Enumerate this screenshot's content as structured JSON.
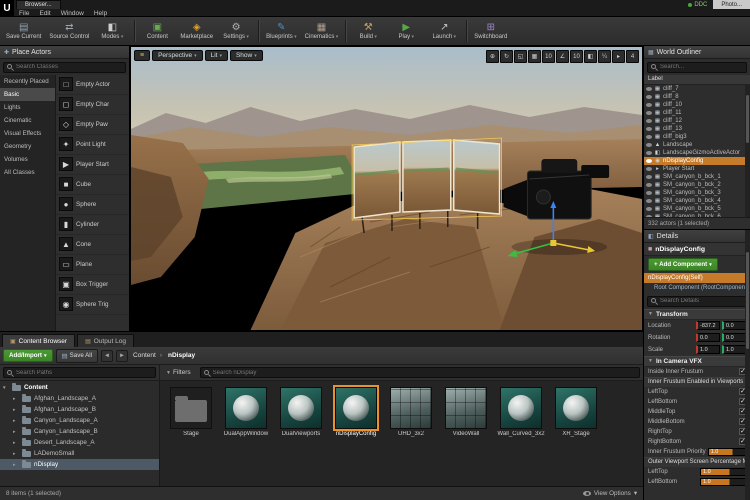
{
  "colors": {
    "selection_orange": "#c57b29",
    "add_green": "#3c8527",
    "thumb_teal": "#16433e",
    "gizmo_yellow": "#e8c832"
  },
  "titlebar": {
    "logo": "U",
    "window_title": "Browser...",
    "menus": [
      "File",
      "Edit",
      "Window",
      "Help"
    ],
    "ddc": "DDC",
    "external_tab": "Photo..."
  },
  "toolbar": {
    "buttons": [
      {
        "label": "Save Current",
        "glyph": "▤"
      },
      {
        "label": "Source Control",
        "glyph": "⇄"
      },
      {
        "label": "Modes",
        "glyph": "◧"
      },
      {
        "label": "Content",
        "glyph": "▣"
      },
      {
        "label": "Marketplace",
        "glyph": "◈"
      },
      {
        "label": "Settings",
        "glyph": "⚙"
      },
      {
        "label": "Blueprints",
        "glyph": "✎"
      },
      {
        "label": "Cinematics",
        "glyph": "▦"
      },
      {
        "label": "Build",
        "glyph": "⚒"
      },
      {
        "label": "Play",
        "glyph": "▶"
      },
      {
        "label": "Launch",
        "glyph": "↗"
      },
      {
        "label": "Switchboard",
        "glyph": "⊞"
      }
    ]
  },
  "place_actors": {
    "title": "Place Actors",
    "search_placeholder": "Search Classes",
    "categories": [
      "Recently Placed",
      "Basic",
      "Lights",
      "Cinematic",
      "Visual Effects",
      "Geometry",
      "Volumes",
      "All Classes"
    ],
    "items": [
      {
        "label": "Empty Actor",
        "glyph": "□"
      },
      {
        "label": "Empty Char",
        "glyph": "◻"
      },
      {
        "label": "Empty Paw",
        "glyph": "◇"
      },
      {
        "label": "Point Light",
        "glyph": "✦"
      },
      {
        "label": "Player Start",
        "glyph": "▶"
      },
      {
        "label": "Cube",
        "glyph": "■"
      },
      {
        "label": "Sphere",
        "glyph": "●"
      },
      {
        "label": "Cylinder",
        "glyph": "▮"
      },
      {
        "label": "Cone",
        "glyph": "▲"
      },
      {
        "label": "Plane",
        "glyph": "▭"
      },
      {
        "label": "Box Trigger",
        "glyph": "▣"
      },
      {
        "label": "Sphere Trig",
        "glyph": "◉"
      }
    ]
  },
  "viewport": {
    "options_icon": "≡",
    "menu_buttons": [
      "Perspective",
      "Lit",
      "Show"
    ],
    "right_tools": [
      "⊕",
      "↻",
      "◱",
      "▦",
      "10",
      "∠",
      "10",
      "◧",
      "¼",
      "▸",
      "4"
    ]
  },
  "world_outliner": {
    "title": "World Outliner",
    "search_placeholder": "Search...",
    "label_header": "Label",
    "items": [
      {
        "label": "cliff_7",
        "glyph": "▦"
      },
      {
        "label": "cliff_8",
        "glyph": "▦"
      },
      {
        "label": "cliff_10",
        "glyph": "▦"
      },
      {
        "label": "cliff_11",
        "glyph": "▦"
      },
      {
        "label": "cliff_12",
        "glyph": "▦"
      },
      {
        "label": "cliff_13",
        "glyph": "▦"
      },
      {
        "label": "cliff_big3",
        "glyph": "▦"
      },
      {
        "label": "Landscape",
        "glyph": "▲"
      },
      {
        "label": "LandscapeGizmoActiveActor",
        "glyph": "◧"
      },
      {
        "label": "nDisplayConfig",
        "glyph": "◉"
      },
      {
        "label": "Player Start",
        "glyph": "▸"
      },
      {
        "label": "SM_canyon_b_bck_1",
        "glyph": "▦"
      },
      {
        "label": "SM_canyon_b_bck_2",
        "glyph": "▦"
      },
      {
        "label": "SM_canyon_b_bck_3",
        "glyph": "▦"
      },
      {
        "label": "SM_canyon_b_bck_4",
        "glyph": "▦"
      },
      {
        "label": "SM_canyon_b_bck_5",
        "glyph": "▦"
      },
      {
        "label": "SM_canyon_b_bck_6",
        "glyph": "▦"
      }
    ],
    "status": "332 actors (1 selected)"
  },
  "details": {
    "title": "Details",
    "object_icon": "■",
    "object_name": "nDisplayConfig",
    "add_component": "+ Add Component",
    "components": [
      {
        "label": "nDisplayConfig(Self)"
      },
      {
        "label": "Root Component (RootComponent)"
      }
    ],
    "search_placeholder": "Search Details",
    "transform": {
      "title": "Transform",
      "rows": [
        {
          "label": "Location",
          "x": "-837.2",
          "y": "0.0"
        },
        {
          "label": "Rotation",
          "x": "0.0",
          "y": "0.0"
        },
        {
          "label": "Scale",
          "x": "1.0",
          "y": "1.0"
        }
      ]
    },
    "vfx": {
      "title": "In Camera VFX",
      "inside_inner_frustum": "Inside Inner Frustum",
      "enabled_header": "Inner Frustum Enabled in Viewports",
      "viewports": [
        "LeftTop",
        "LeftBottom",
        "MiddleTop",
        "MiddleBottom",
        "RightTop",
        "RightBottom"
      ],
      "priority_label": "Inner Frustum Priority",
      "priority_value": "1.0",
      "pct_header": "Outer Viewport Screen Percentage M",
      "pct_rows": [
        {
          "label": "LeftTop",
          "value": "1.0"
        },
        {
          "label": "LeftBottom",
          "value": "1.0"
        }
      ]
    }
  },
  "content_browser": {
    "tabs": [
      "Content Browser",
      "Output Log"
    ],
    "add_import": "Add/Import",
    "save_all": "Save All",
    "breadcrumb": [
      "Content",
      "nDisplay"
    ],
    "filters": "Filters",
    "search_placeholder": "Search nDisplay",
    "paths_placeholder": "Search Paths",
    "tree": [
      {
        "label": "Content"
      },
      {
        "label": "Afghan_Landscape_A"
      },
      {
        "label": "Afghan_Landscape_B"
      },
      {
        "label": "Canyon_Landscape_A"
      },
      {
        "label": "Canyon_Landscape_B"
      },
      {
        "label": "Desert_Landscape_A"
      },
      {
        "label": "LADemoSmall"
      },
      {
        "label": "nDisplay"
      }
    ],
    "assets": [
      {
        "label": "Stage",
        "kind": "folder"
      },
      {
        "label": "DualAppWindow",
        "kind": "sphere"
      },
      {
        "label": "DualViewports",
        "kind": "sphere"
      },
      {
        "label": "nDisplayConfig",
        "kind": "sphere"
      },
      {
        "label": "UHD_3x2",
        "kind": "panel"
      },
      {
        "label": "VideoWall",
        "kind": "panel"
      },
      {
        "label": "Wall_Curved_3x2",
        "kind": "sphere"
      },
      {
        "label": "XR_Stage",
        "kind": "sphere"
      }
    ],
    "status": "8 items (1 selected)",
    "view_options": "View Options"
  }
}
